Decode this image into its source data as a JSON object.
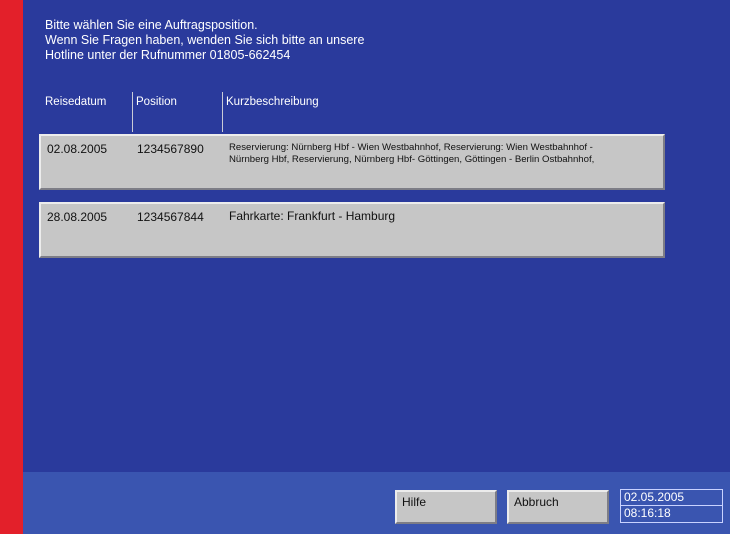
{
  "instructions": {
    "line1": "Bitte wählen Sie eine Auftragsposition.",
    "line2": "Wenn Sie Fragen haben, wenden Sie sich bitte an unsere",
    "line3": "Hotline unter der Rufnummer 01805-662454"
  },
  "table": {
    "columns": [
      "Reisedatum",
      "Position",
      "Kurzbeschreibung"
    ],
    "rows": [
      {
        "date": "02.08.2005",
        "position": "1234567890",
        "description_line1": "Reservierung: Nürnberg Hbf - Wien Westbahnhof, Reservierung: Wien Westbahnhof -",
        "description_line2": "Nürnberg Hbf, Reservierung, Nürnberg Hbf- Göttingen, Göttingen - Berlin Ostbahnhof,"
      },
      {
        "date": "28.08.2005",
        "position": "1234567844",
        "description_line1": "Fahrkarte: Frankfurt - Hamburg"
      }
    ]
  },
  "footer": {
    "help_label": "Hilfe",
    "cancel_label": "Abbruch",
    "date": "02.05.2005",
    "time": "08:16:18"
  },
  "colors": {
    "background": "#2a3a9c",
    "footer": "#3a55b0",
    "accent_bar": "#e3202a",
    "row": "#c6c6c6"
  }
}
